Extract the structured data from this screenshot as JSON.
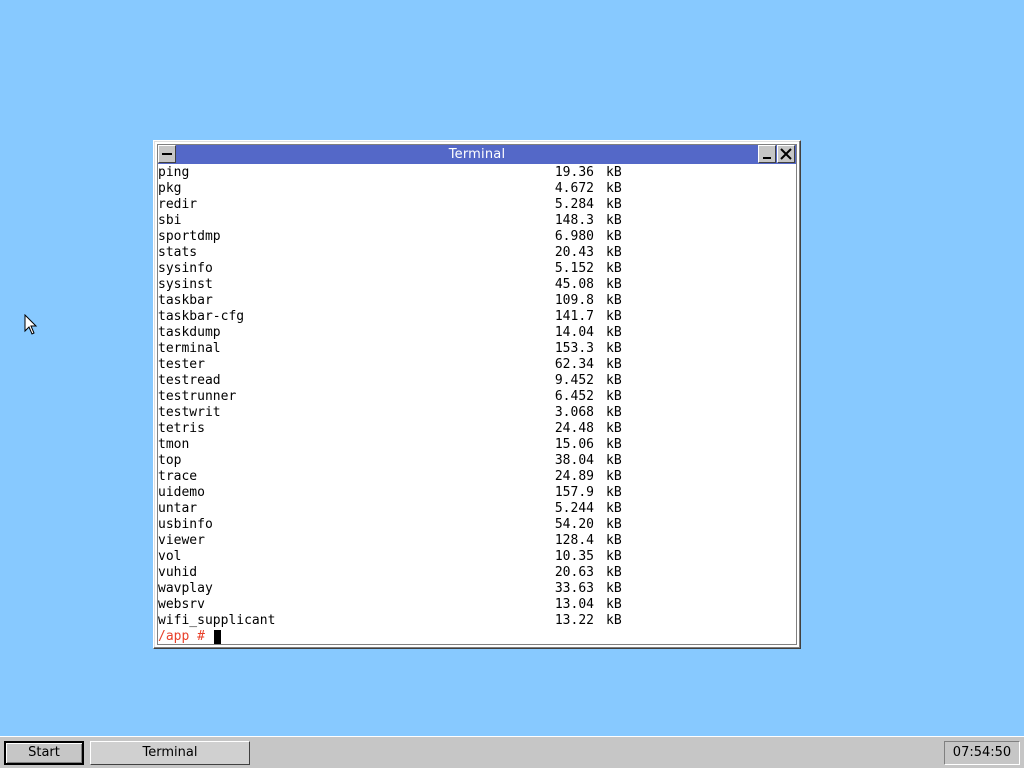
{
  "colors": {
    "desktop_bg": "#87c9ff",
    "titlebar_bg": "#5468c8",
    "prompt_color": "#e8402a",
    "taskbar_bg": "#c6c6c6"
  },
  "window": {
    "title": "Terminal",
    "menu_icon": "window-menu-icon",
    "minimize_icon": "minimize-icon",
    "close_icon": "close-icon"
  },
  "terminal": {
    "files": [
      {
        "name": "ping",
        "size": "19.36",
        "unit": "kB"
      },
      {
        "name": "pkg",
        "size": "4.672",
        "unit": "kB"
      },
      {
        "name": "redir",
        "size": "5.284",
        "unit": "kB"
      },
      {
        "name": "sbi",
        "size": "148.3",
        "unit": "kB"
      },
      {
        "name": "sportdmp",
        "size": "6.980",
        "unit": "kB"
      },
      {
        "name": "stats",
        "size": "20.43",
        "unit": "kB"
      },
      {
        "name": "sysinfo",
        "size": "5.152",
        "unit": "kB"
      },
      {
        "name": "sysinst",
        "size": "45.08",
        "unit": "kB"
      },
      {
        "name": "taskbar",
        "size": "109.8",
        "unit": "kB"
      },
      {
        "name": "taskbar-cfg",
        "size": "141.7",
        "unit": "kB"
      },
      {
        "name": "taskdump",
        "size": "14.04",
        "unit": "kB"
      },
      {
        "name": "terminal",
        "size": "153.3",
        "unit": "kB"
      },
      {
        "name": "tester",
        "size": "62.34",
        "unit": "kB"
      },
      {
        "name": "testread",
        "size": "9.452",
        "unit": "kB"
      },
      {
        "name": "testrunner",
        "size": "6.452",
        "unit": "kB"
      },
      {
        "name": "testwrit",
        "size": "3.068",
        "unit": "kB"
      },
      {
        "name": "tetris",
        "size": "24.48",
        "unit": "kB"
      },
      {
        "name": "tmon",
        "size": "15.06",
        "unit": "kB"
      },
      {
        "name": "top",
        "size": "38.04",
        "unit": "kB"
      },
      {
        "name": "trace",
        "size": "24.89",
        "unit": "kB"
      },
      {
        "name": "uidemo",
        "size": "157.9",
        "unit": "kB"
      },
      {
        "name": "untar",
        "size": "5.244",
        "unit": "kB"
      },
      {
        "name": "usbinfo",
        "size": "54.20",
        "unit": "kB"
      },
      {
        "name": "viewer",
        "size": "128.4",
        "unit": "kB"
      },
      {
        "name": "vol",
        "size": "10.35",
        "unit": "kB"
      },
      {
        "name": "vuhid",
        "size": "20.63",
        "unit": "kB"
      },
      {
        "name": "wavplay",
        "size": "33.63",
        "unit": "kB"
      },
      {
        "name": "websrv",
        "size": "13.04",
        "unit": "kB"
      },
      {
        "name": "wifi_supplicant",
        "size": "13.22",
        "unit": "kB"
      }
    ],
    "prompt": "/app #"
  },
  "taskbar": {
    "start_label": "Start",
    "task_label": "Terminal",
    "clock": "07:54:50"
  },
  "desktop": {
    "cursor_icon": "mouse-pointer-icon"
  }
}
